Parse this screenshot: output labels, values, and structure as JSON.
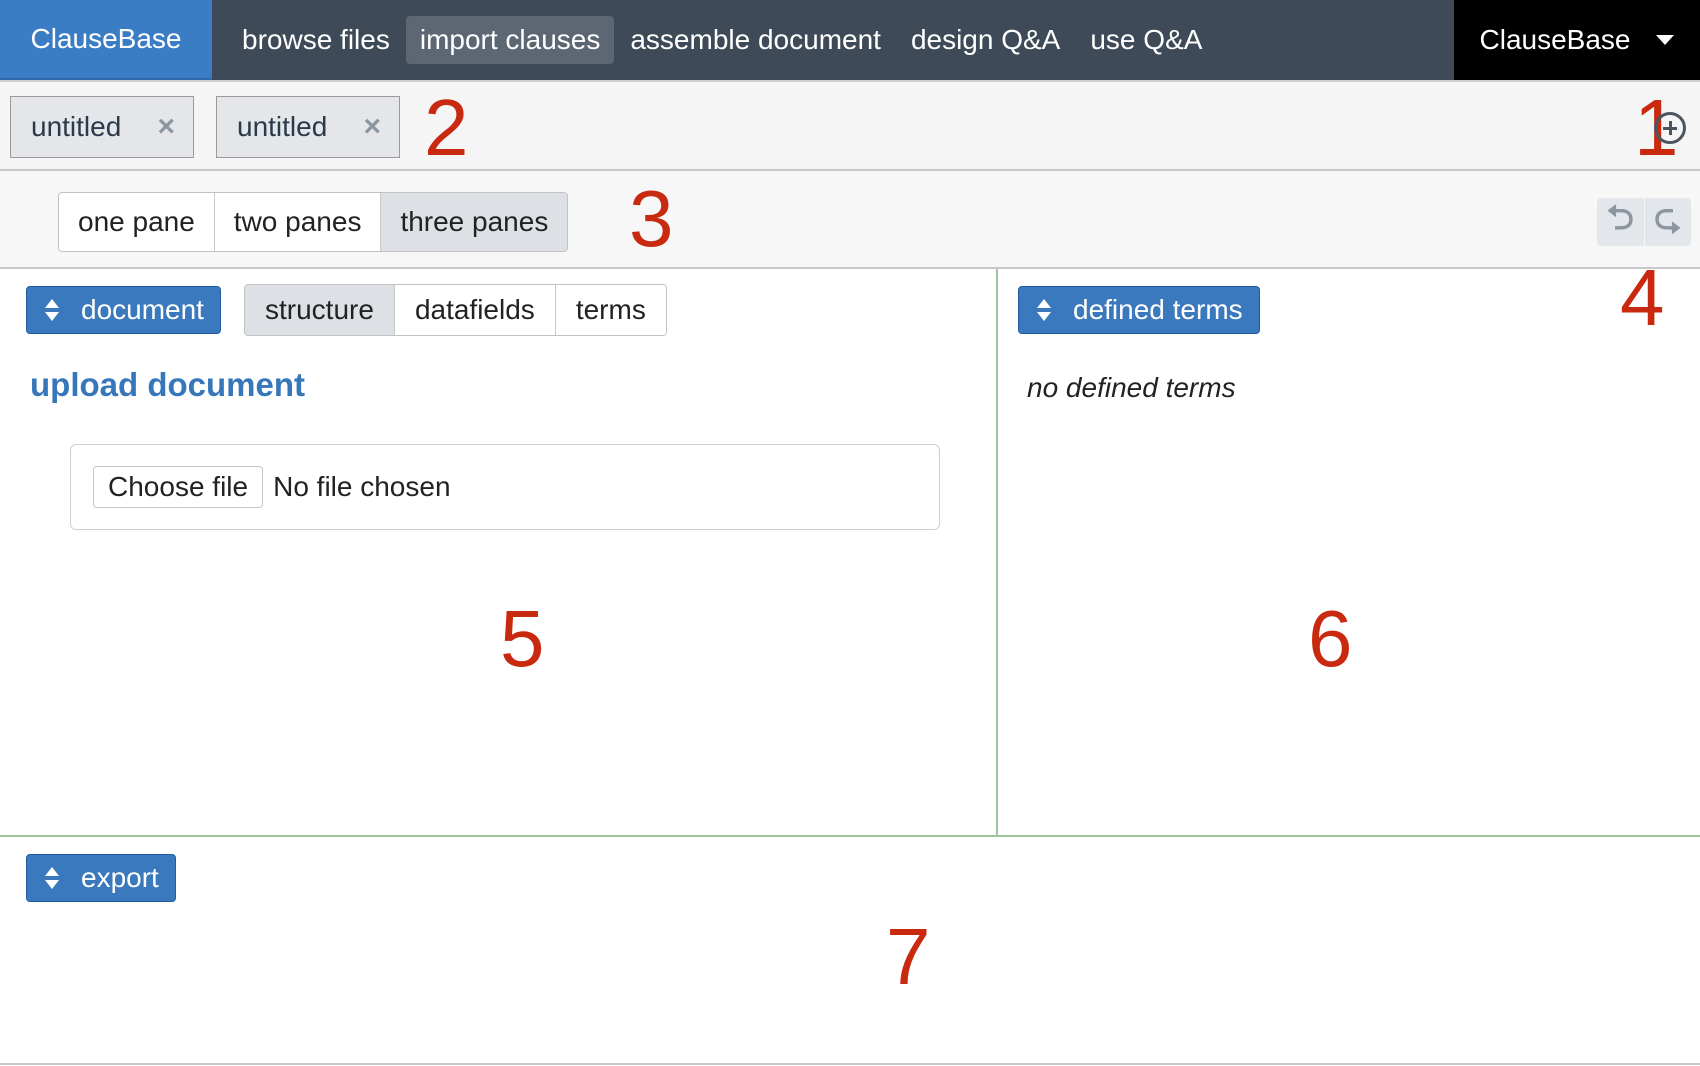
{
  "navbar": {
    "brand": "ClauseBase",
    "items": [
      {
        "label": "browse files",
        "active": false
      },
      {
        "label": "import clauses",
        "active": true
      },
      {
        "label": "assemble document",
        "active": false
      },
      {
        "label": "design Q&A",
        "active": false
      },
      {
        "label": "use Q&A",
        "active": false
      }
    ],
    "account_label": "ClauseBase",
    "account_icon": "caret-down-icon"
  },
  "document_tabs": [
    {
      "label": "untitled",
      "close_icon": "close-icon",
      "close_glyph": "×"
    },
    {
      "label": "untitled",
      "close_icon": "close-icon",
      "close_glyph": "×"
    }
  ],
  "add_tab_icon": "plus-circle-icon",
  "pane_selector": {
    "options": [
      {
        "label": "one pane",
        "active": false
      },
      {
        "label": "two panes",
        "active": false
      },
      {
        "label": "three panes",
        "active": true
      }
    ]
  },
  "history": {
    "undo_icon": "undo-icon",
    "undo_glyph": "⮌",
    "redo_icon": "redo-icon",
    "redo_glyph": "⮎"
  },
  "left_pane": {
    "selector_label": "document",
    "view_tabs": [
      {
        "label": "structure",
        "active": true
      },
      {
        "label": "datafields",
        "active": false
      },
      {
        "label": "terms",
        "active": false
      }
    ],
    "upload_title": "upload document",
    "choose_file_label": "Choose file",
    "file_status": "No file chosen"
  },
  "right_pane": {
    "selector_label": "defined terms",
    "empty_text": "no defined terms"
  },
  "bottom_pane": {
    "selector_label": "export"
  },
  "annotations": [
    "1",
    "2",
    "3",
    "4",
    "5",
    "6",
    "7"
  ],
  "colors": {
    "brand_blue": "#3b7dc4",
    "navbar_bg": "#3e4a57",
    "button_blue": "#3a79be",
    "annotation_red": "#c8290f",
    "pane_divider": "#9cc59c"
  }
}
